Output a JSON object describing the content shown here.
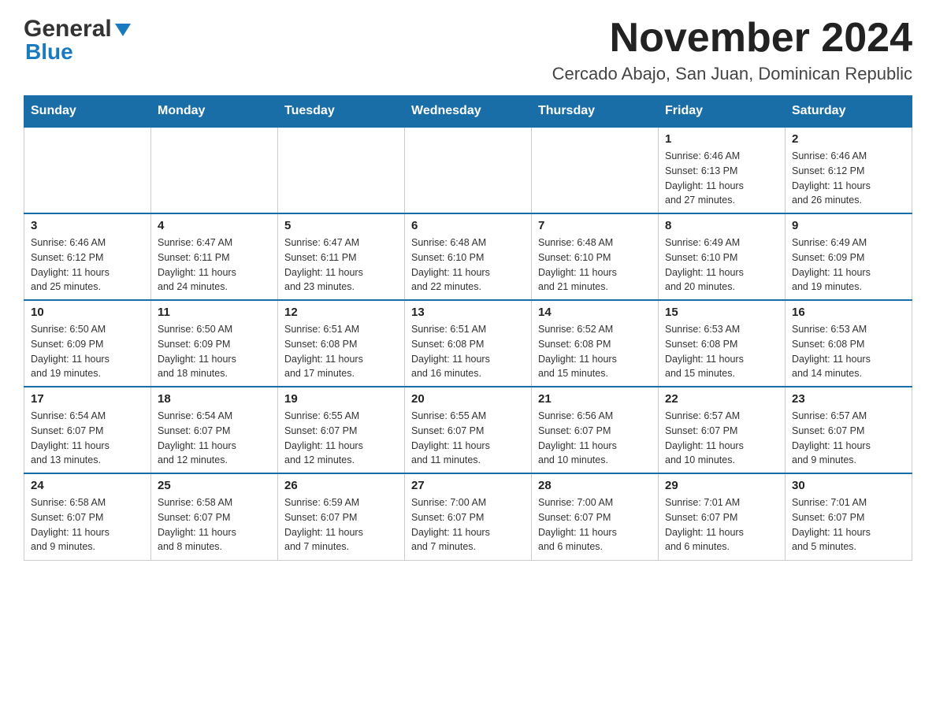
{
  "logo": {
    "general": "General",
    "blue": "Blue"
  },
  "header": {
    "month_year": "November 2024",
    "location": "Cercado Abajo, San Juan, Dominican Republic"
  },
  "days_of_week": [
    "Sunday",
    "Monday",
    "Tuesday",
    "Wednesday",
    "Thursday",
    "Friday",
    "Saturday"
  ],
  "weeks": [
    [
      {
        "day": "",
        "info": ""
      },
      {
        "day": "",
        "info": ""
      },
      {
        "day": "",
        "info": ""
      },
      {
        "day": "",
        "info": ""
      },
      {
        "day": "",
        "info": ""
      },
      {
        "day": "1",
        "info": "Sunrise: 6:46 AM\nSunset: 6:13 PM\nDaylight: 11 hours\nand 27 minutes."
      },
      {
        "day": "2",
        "info": "Sunrise: 6:46 AM\nSunset: 6:12 PM\nDaylight: 11 hours\nand 26 minutes."
      }
    ],
    [
      {
        "day": "3",
        "info": "Sunrise: 6:46 AM\nSunset: 6:12 PM\nDaylight: 11 hours\nand 25 minutes."
      },
      {
        "day": "4",
        "info": "Sunrise: 6:47 AM\nSunset: 6:11 PM\nDaylight: 11 hours\nand 24 minutes."
      },
      {
        "day": "5",
        "info": "Sunrise: 6:47 AM\nSunset: 6:11 PM\nDaylight: 11 hours\nand 23 minutes."
      },
      {
        "day": "6",
        "info": "Sunrise: 6:48 AM\nSunset: 6:10 PM\nDaylight: 11 hours\nand 22 minutes."
      },
      {
        "day": "7",
        "info": "Sunrise: 6:48 AM\nSunset: 6:10 PM\nDaylight: 11 hours\nand 21 minutes."
      },
      {
        "day": "8",
        "info": "Sunrise: 6:49 AM\nSunset: 6:10 PM\nDaylight: 11 hours\nand 20 minutes."
      },
      {
        "day": "9",
        "info": "Sunrise: 6:49 AM\nSunset: 6:09 PM\nDaylight: 11 hours\nand 19 minutes."
      }
    ],
    [
      {
        "day": "10",
        "info": "Sunrise: 6:50 AM\nSunset: 6:09 PM\nDaylight: 11 hours\nand 19 minutes."
      },
      {
        "day": "11",
        "info": "Sunrise: 6:50 AM\nSunset: 6:09 PM\nDaylight: 11 hours\nand 18 minutes."
      },
      {
        "day": "12",
        "info": "Sunrise: 6:51 AM\nSunset: 6:08 PM\nDaylight: 11 hours\nand 17 minutes."
      },
      {
        "day": "13",
        "info": "Sunrise: 6:51 AM\nSunset: 6:08 PM\nDaylight: 11 hours\nand 16 minutes."
      },
      {
        "day": "14",
        "info": "Sunrise: 6:52 AM\nSunset: 6:08 PM\nDaylight: 11 hours\nand 15 minutes."
      },
      {
        "day": "15",
        "info": "Sunrise: 6:53 AM\nSunset: 6:08 PM\nDaylight: 11 hours\nand 15 minutes."
      },
      {
        "day": "16",
        "info": "Sunrise: 6:53 AM\nSunset: 6:08 PM\nDaylight: 11 hours\nand 14 minutes."
      }
    ],
    [
      {
        "day": "17",
        "info": "Sunrise: 6:54 AM\nSunset: 6:07 PM\nDaylight: 11 hours\nand 13 minutes."
      },
      {
        "day": "18",
        "info": "Sunrise: 6:54 AM\nSunset: 6:07 PM\nDaylight: 11 hours\nand 12 minutes."
      },
      {
        "day": "19",
        "info": "Sunrise: 6:55 AM\nSunset: 6:07 PM\nDaylight: 11 hours\nand 12 minutes."
      },
      {
        "day": "20",
        "info": "Sunrise: 6:55 AM\nSunset: 6:07 PM\nDaylight: 11 hours\nand 11 minutes."
      },
      {
        "day": "21",
        "info": "Sunrise: 6:56 AM\nSunset: 6:07 PM\nDaylight: 11 hours\nand 10 minutes."
      },
      {
        "day": "22",
        "info": "Sunrise: 6:57 AM\nSunset: 6:07 PM\nDaylight: 11 hours\nand 10 minutes."
      },
      {
        "day": "23",
        "info": "Sunrise: 6:57 AM\nSunset: 6:07 PM\nDaylight: 11 hours\nand 9 minutes."
      }
    ],
    [
      {
        "day": "24",
        "info": "Sunrise: 6:58 AM\nSunset: 6:07 PM\nDaylight: 11 hours\nand 9 minutes."
      },
      {
        "day": "25",
        "info": "Sunrise: 6:58 AM\nSunset: 6:07 PM\nDaylight: 11 hours\nand 8 minutes."
      },
      {
        "day": "26",
        "info": "Sunrise: 6:59 AM\nSunset: 6:07 PM\nDaylight: 11 hours\nand 7 minutes."
      },
      {
        "day": "27",
        "info": "Sunrise: 7:00 AM\nSunset: 6:07 PM\nDaylight: 11 hours\nand 7 minutes."
      },
      {
        "day": "28",
        "info": "Sunrise: 7:00 AM\nSunset: 6:07 PM\nDaylight: 11 hours\nand 6 minutes."
      },
      {
        "day": "29",
        "info": "Sunrise: 7:01 AM\nSunset: 6:07 PM\nDaylight: 11 hours\nand 6 minutes."
      },
      {
        "day": "30",
        "info": "Sunrise: 7:01 AM\nSunset: 6:07 PM\nDaylight: 11 hours\nand 5 minutes."
      }
    ]
  ]
}
